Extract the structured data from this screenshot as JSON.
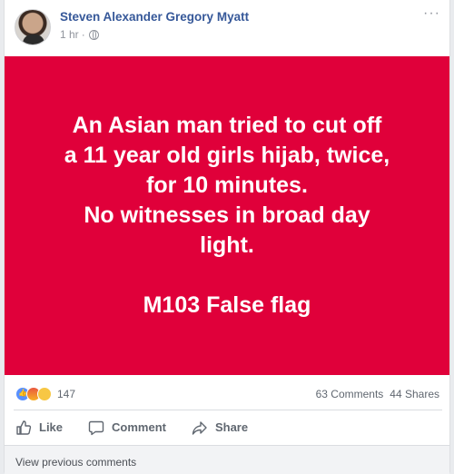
{
  "post": {
    "author": "Steven Alexander Gregory Myatt",
    "time": "1 hr",
    "separator": "·",
    "more_icon": "ellipsis-icon",
    "body_color": "#e0003a",
    "body_lines": [
      "An Asian man tried to cut off",
      "a 11 year old girls hijab, twice,",
      "for 10 minutes.",
      "No witnesses in broad day",
      "light."
    ],
    "body_footer": "M103 False flag"
  },
  "stats": {
    "reaction_count": "147",
    "comments": "63 Comments",
    "shares": "44 Shares",
    "reaction_icons": [
      "like-icon",
      "angry-icon",
      "haha-icon"
    ]
  },
  "actions": {
    "like": "Like",
    "comment": "Comment",
    "share": "Share"
  },
  "comments": {
    "view_previous": "View previous comments"
  },
  "colors": {
    "author_link": "#365899",
    "meta_text": "#90949c",
    "action_text": "#606770"
  }
}
